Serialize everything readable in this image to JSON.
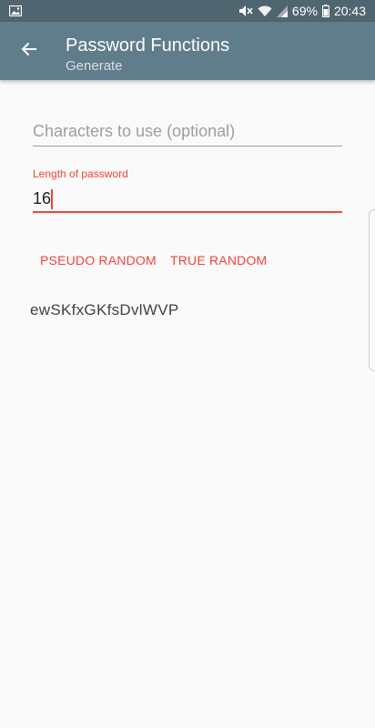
{
  "status_bar": {
    "battery_percent": "69%",
    "time": "20:43",
    "icons": [
      "image-icon",
      "mute-icon",
      "wifi-icon",
      "signal-icon",
      "battery-icon"
    ]
  },
  "app_bar": {
    "title": "Password Functions",
    "subtitle": "Generate",
    "back_icon": "arrow-back-icon",
    "color": "#607d8b"
  },
  "form": {
    "characters": {
      "placeholder": "Characters to use (optional)",
      "value": ""
    },
    "length": {
      "label": "Length of password",
      "value": "16"
    }
  },
  "buttons": {
    "pseudo_random": "PSEUDO RANDOM",
    "true_random": "TRUE RANDOM"
  },
  "result": {
    "password": "ewSKfxGKfsDvlWVP"
  },
  "colors": {
    "accent": "#f44336",
    "status_bar": "#4f6670"
  }
}
